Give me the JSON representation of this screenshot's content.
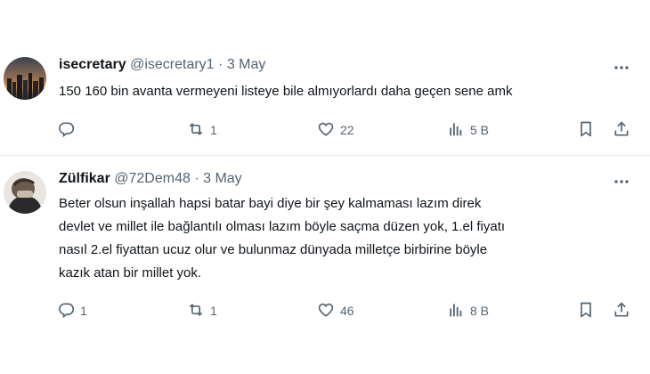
{
  "tweets": [
    {
      "name": "isecretary",
      "handle": "@isecretary1",
      "dot": "·",
      "date": "3 May",
      "text": "150 160 bin avanta vermeyeni listeye bile almıyorlardı daha geçen sene amk",
      "replies": "",
      "retweets": "1",
      "likes": "22",
      "views": "5 B"
    },
    {
      "name": "Zülfikar",
      "handle": "@72Dem48",
      "dot": "·",
      "date": "3 May",
      "text_lines": [
        "Beter olsun inşallah hapsi batar bayi diye bir şey kalmaması lazım direk",
        "devlet ve millet ile bağlantılı olması lazım böyle saçma düzen yok, 1.el fiyatı",
        "nasıl 2.el fiyattan ucuz olur ve bulunmaz dünyada milletçe birbirine böyle",
        "kazık atan bir millet yok."
      ],
      "replies": "1",
      "retweets": "1",
      "likes": "46",
      "views": "8 B"
    }
  ],
  "icons": {
    "reply": "reply-icon",
    "retweet": "retweet-icon",
    "like": "heart-icon",
    "views": "views-icon",
    "bookmark": "bookmark-icon",
    "share": "share-icon",
    "more": "more-icon"
  },
  "colors": {
    "text": "#0f1419",
    "secondary": "#536471",
    "divider": "#e6e9eb"
  }
}
